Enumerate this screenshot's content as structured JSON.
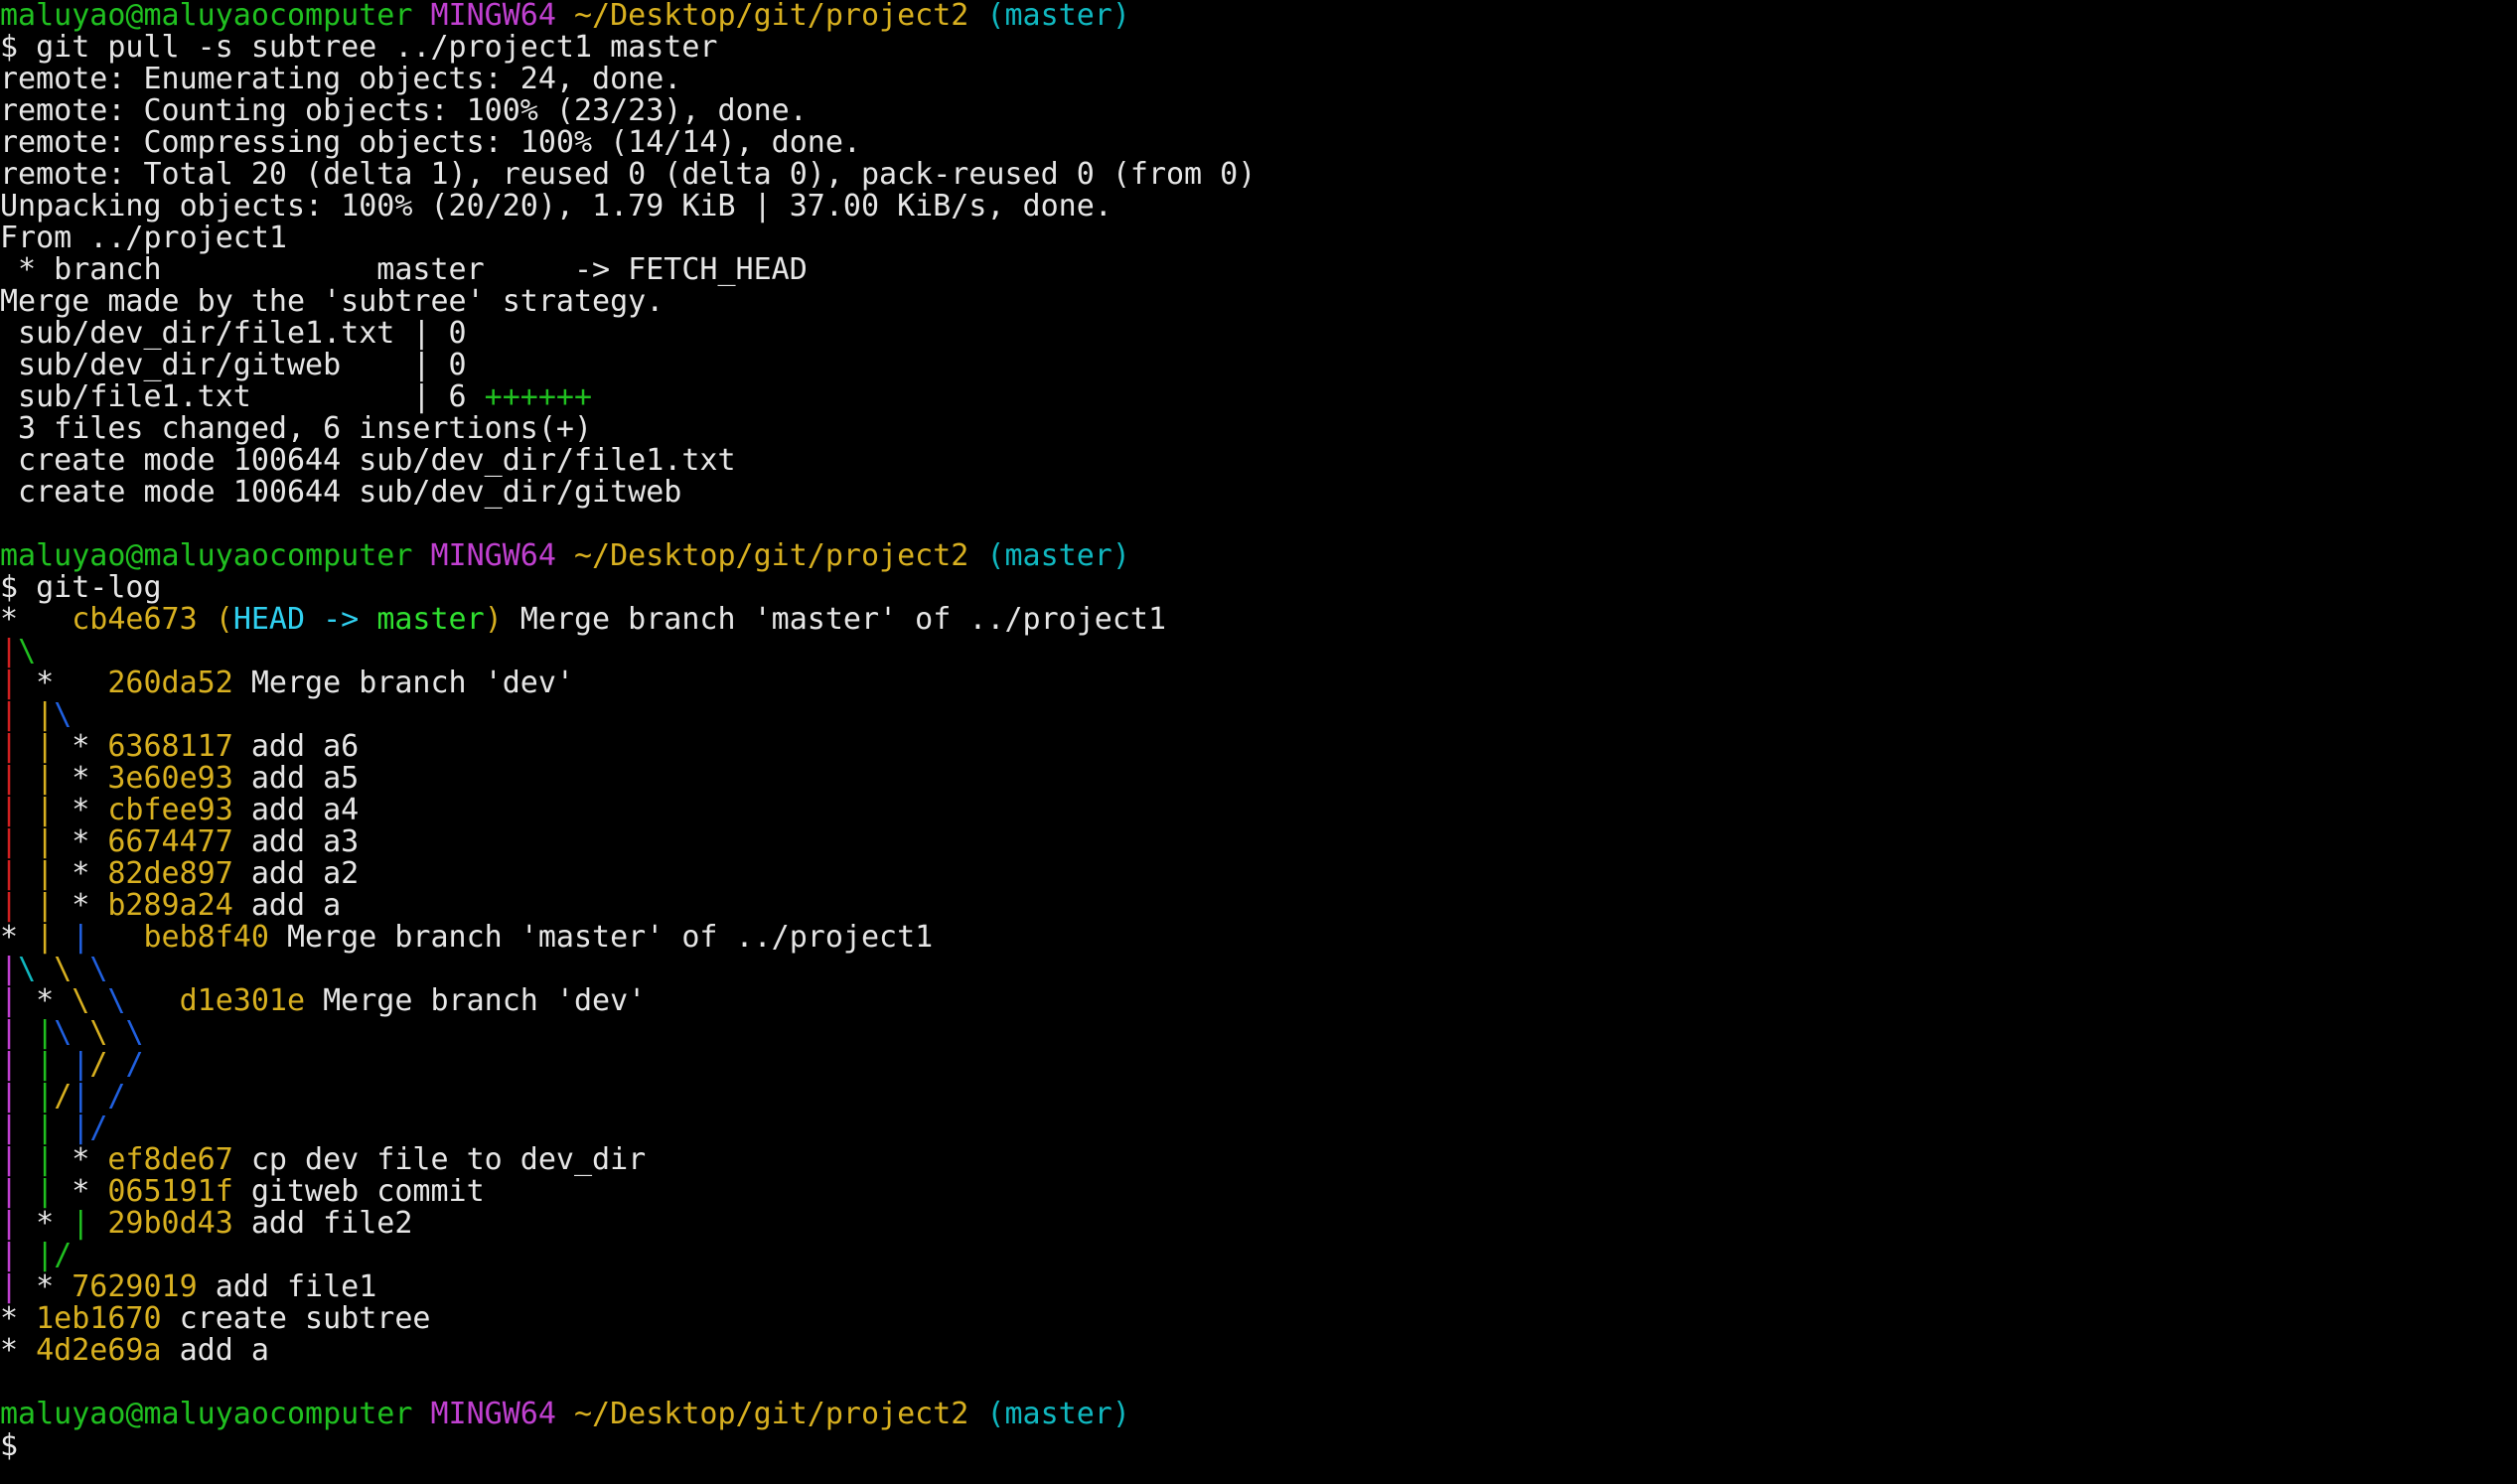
{
  "colors": {
    "fg": "#e6e6e6",
    "green": "#20c020",
    "magenta": "#c040d0",
    "yellow": "#d8b020",
    "cyan": "#10b8c0",
    "red": "#d02020",
    "blue": "#2060e0",
    "bright_cyan": "#30d0f0",
    "bright_green": "#30e030"
  },
  "terminal": {
    "lines": [
      [
        {
          "t": "maluyao@maluyaocomputer",
          "c": "green"
        },
        {
          "t": " "
        },
        {
          "t": "MINGW64",
          "c": "magenta"
        },
        {
          "t": " "
        },
        {
          "t": "~/Desktop/git/project2",
          "c": "yellow"
        },
        {
          "t": " "
        },
        {
          "t": "(master)",
          "c": "cyan"
        }
      ],
      [
        {
          "t": "$ git pull -s subtree ../project1 master"
        }
      ],
      [
        {
          "t": "remote: Enumerating objects: 24, done."
        }
      ],
      [
        {
          "t": "remote: Counting objects: 100% (23/23), done."
        }
      ],
      [
        {
          "t": "remote: Compressing objects: 100% (14/14), done."
        }
      ],
      [
        {
          "t": "remote: Total 20 (delta 1), reused 0 (delta 0), pack-reused 0 (from 0)"
        }
      ],
      [
        {
          "t": "Unpacking objects: 100% (20/20), 1.79 KiB | 37.00 KiB/s, done."
        }
      ],
      [
        {
          "t": "From ../project1"
        }
      ],
      [
        {
          "t": " * branch            master     -> FETCH_HEAD"
        }
      ],
      [
        {
          "t": "Merge made by the 'subtree' strategy."
        }
      ],
      [
        {
          "t": " sub/dev_dir/file1.txt | 0"
        }
      ],
      [
        {
          "t": " sub/dev_dir/gitweb    | 0"
        }
      ],
      [
        {
          "t": " sub/file1.txt         | 6 "
        },
        {
          "t": "++++++",
          "c": "green"
        }
      ],
      [
        {
          "t": " 3 files changed, 6 insertions(+)"
        }
      ],
      [
        {
          "t": " create mode 100644 sub/dev_dir/file1.txt"
        }
      ],
      [
        {
          "t": " create mode 100644 sub/dev_dir/gitweb"
        }
      ],
      [],
      [
        {
          "t": "maluyao@maluyaocomputer",
          "c": "green"
        },
        {
          "t": " "
        },
        {
          "t": "MINGW64",
          "c": "magenta"
        },
        {
          "t": " "
        },
        {
          "t": "~/Desktop/git/project2",
          "c": "yellow"
        },
        {
          "t": " "
        },
        {
          "t": "(master)",
          "c": "cyan"
        }
      ],
      [
        {
          "t": "$ git-log"
        }
      ],
      [
        {
          "t": "*   "
        },
        {
          "t": "cb4e673 ",
          "c": "yellow"
        },
        {
          "t": "(",
          "c": "yellow"
        },
        {
          "t": "HEAD -> ",
          "c": "bright_cyan"
        },
        {
          "t": "master",
          "c": "bright_green"
        },
        {
          "t": ")",
          "c": "yellow"
        },
        {
          "t": " Merge branch 'master' of ../project1"
        }
      ],
      [
        {
          "t": "|",
          "c": "red"
        },
        {
          "t": "\\",
          "c": "green"
        }
      ],
      [
        {
          "t": "|",
          "c": "red"
        },
        {
          "t": " *   "
        },
        {
          "t": "260da52",
          "c": "yellow"
        },
        {
          "t": " Merge branch 'dev'"
        }
      ],
      [
        {
          "t": "|",
          "c": "red"
        },
        {
          "t": " "
        },
        {
          "t": "|",
          "c": "yellow"
        },
        {
          "t": "\\",
          "c": "blue"
        }
      ],
      [
        {
          "t": "|",
          "c": "red"
        },
        {
          "t": " "
        },
        {
          "t": "|",
          "c": "yellow"
        },
        {
          "t": " * "
        },
        {
          "t": "6368117",
          "c": "yellow"
        },
        {
          "t": " add a6"
        }
      ],
      [
        {
          "t": "|",
          "c": "red"
        },
        {
          "t": " "
        },
        {
          "t": "|",
          "c": "yellow"
        },
        {
          "t": " * "
        },
        {
          "t": "3e60e93",
          "c": "yellow"
        },
        {
          "t": " add a5"
        }
      ],
      [
        {
          "t": "|",
          "c": "red"
        },
        {
          "t": " "
        },
        {
          "t": "|",
          "c": "yellow"
        },
        {
          "t": " * "
        },
        {
          "t": "cbfee93",
          "c": "yellow"
        },
        {
          "t": " add a4"
        }
      ],
      [
        {
          "t": "|",
          "c": "red"
        },
        {
          "t": " "
        },
        {
          "t": "|",
          "c": "yellow"
        },
        {
          "t": " * "
        },
        {
          "t": "6674477",
          "c": "yellow"
        },
        {
          "t": " add a3"
        }
      ],
      [
        {
          "t": "|",
          "c": "red"
        },
        {
          "t": " "
        },
        {
          "t": "|",
          "c": "yellow"
        },
        {
          "t": " * "
        },
        {
          "t": "82de897",
          "c": "yellow"
        },
        {
          "t": " add a2"
        }
      ],
      [
        {
          "t": "|",
          "c": "red"
        },
        {
          "t": " "
        },
        {
          "t": "|",
          "c": "yellow"
        },
        {
          "t": " * "
        },
        {
          "t": "b289a24",
          "c": "yellow"
        },
        {
          "t": " add a"
        }
      ],
      [
        {
          "t": "* "
        },
        {
          "t": "|",
          "c": "yellow"
        },
        {
          "t": " "
        },
        {
          "t": "|",
          "c": "blue"
        },
        {
          "t": "   "
        },
        {
          "t": "beb8f40",
          "c": "yellow"
        },
        {
          "t": " Merge branch 'master' of ../project1"
        }
      ],
      [
        {
          "t": "|",
          "c": "magenta"
        },
        {
          "t": "\\",
          "c": "cyan"
        },
        {
          "t": " "
        },
        {
          "t": "\\",
          "c": "yellow"
        },
        {
          "t": " "
        },
        {
          "t": "\\",
          "c": "blue"
        }
      ],
      [
        {
          "t": "|",
          "c": "magenta"
        },
        {
          "t": " * "
        },
        {
          "t": "\\",
          "c": "yellow"
        },
        {
          "t": " "
        },
        {
          "t": "\\",
          "c": "blue"
        },
        {
          "t": "   "
        },
        {
          "t": "d1e301e",
          "c": "yellow"
        },
        {
          "t": " Merge branch 'dev'"
        }
      ],
      [
        {
          "t": "|",
          "c": "magenta"
        },
        {
          "t": " "
        },
        {
          "t": "|",
          "c": "green"
        },
        {
          "t": "\\",
          "c": "blue"
        },
        {
          "t": " "
        },
        {
          "t": "\\",
          "c": "yellow"
        },
        {
          "t": " "
        },
        {
          "t": "\\",
          "c": "blue"
        }
      ],
      [
        {
          "t": "|",
          "c": "magenta"
        },
        {
          "t": " "
        },
        {
          "t": "|",
          "c": "green"
        },
        {
          "t": " "
        },
        {
          "t": "|",
          "c": "blue"
        },
        {
          "t": "/",
          "c": "yellow"
        },
        {
          "t": " "
        },
        {
          "t": "/",
          "c": "blue"
        }
      ],
      [
        {
          "t": "|",
          "c": "magenta"
        },
        {
          "t": " "
        },
        {
          "t": "|",
          "c": "green"
        },
        {
          "t": "/",
          "c": "yellow"
        },
        {
          "t": "|",
          "c": "blue"
        },
        {
          "t": " "
        },
        {
          "t": "/",
          "c": "blue"
        }
      ],
      [
        {
          "t": "|",
          "c": "magenta"
        },
        {
          "t": " "
        },
        {
          "t": "|",
          "c": "green"
        },
        {
          "t": " "
        },
        {
          "t": "|",
          "c": "blue"
        },
        {
          "t": "/",
          "c": "blue"
        }
      ],
      [
        {
          "t": "|",
          "c": "magenta"
        },
        {
          "t": " "
        },
        {
          "t": "|",
          "c": "green"
        },
        {
          "t": " * "
        },
        {
          "t": "ef8de67",
          "c": "yellow"
        },
        {
          "t": " cp dev file to dev_dir"
        }
      ],
      [
        {
          "t": "|",
          "c": "magenta"
        },
        {
          "t": " "
        },
        {
          "t": "|",
          "c": "green"
        },
        {
          "t": " * "
        },
        {
          "t": "065191f",
          "c": "yellow"
        },
        {
          "t": " gitweb commit"
        }
      ],
      [
        {
          "t": "|",
          "c": "magenta"
        },
        {
          "t": " * "
        },
        {
          "t": "|",
          "c": "green"
        },
        {
          "t": " "
        },
        {
          "t": "29b0d43",
          "c": "yellow"
        },
        {
          "t": " add file2"
        }
      ],
      [
        {
          "t": "|",
          "c": "magenta"
        },
        {
          "t": " "
        },
        {
          "t": "|",
          "c": "green"
        },
        {
          "t": "/",
          "c": "green"
        }
      ],
      [
        {
          "t": "|",
          "c": "magenta"
        },
        {
          "t": " * "
        },
        {
          "t": "7629019",
          "c": "yellow"
        },
        {
          "t": " add file1"
        }
      ],
      [
        {
          "t": "* "
        },
        {
          "t": "1eb1670",
          "c": "yellow"
        },
        {
          "t": " create subtree"
        }
      ],
      [
        {
          "t": "* "
        },
        {
          "t": "4d2e69a",
          "c": "yellow"
        },
        {
          "t": " add a"
        }
      ],
      [],
      [
        {
          "t": "maluyao@maluyaocomputer",
          "c": "green"
        },
        {
          "t": " "
        },
        {
          "t": "MINGW64",
          "c": "magenta"
        },
        {
          "t": " "
        },
        {
          "t": "~/Desktop/git/project2",
          "c": "yellow"
        },
        {
          "t": " "
        },
        {
          "t": "(master)",
          "c": "cyan"
        }
      ],
      [
        {
          "t": "$ "
        }
      ]
    ]
  }
}
